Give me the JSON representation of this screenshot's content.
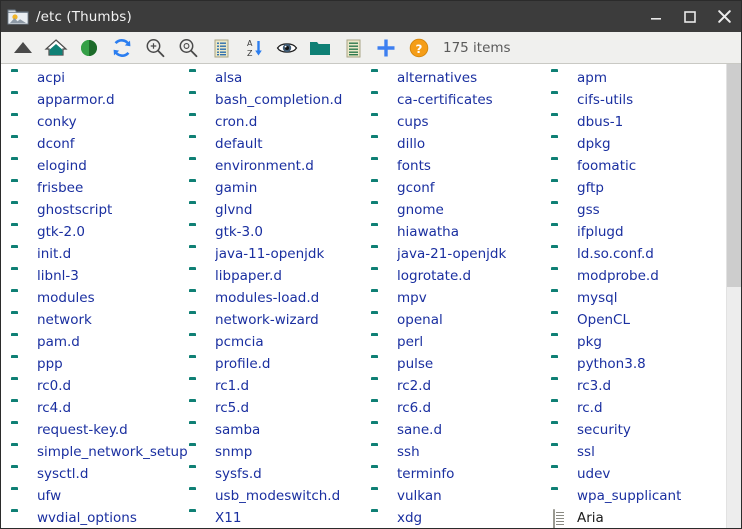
{
  "window": {
    "title": "/etc (Thumbs)",
    "app_icon": "folder-image-icon",
    "controls": {
      "minimize": "minimize-icon",
      "maximize": "maximize-icon",
      "close": "close-icon"
    }
  },
  "toolbar": {
    "status_text": "175 items",
    "buttons": [
      {
        "name": "up-icon",
        "title": "Up"
      },
      {
        "name": "home-icon",
        "title": "Home"
      },
      {
        "name": "back-icon",
        "title": "Back"
      },
      {
        "name": "refresh-icon",
        "title": "Refresh"
      },
      {
        "name": "zoom-in-icon",
        "title": "Zoom In"
      },
      {
        "name": "zoom-out-icon",
        "title": "Zoom Out"
      },
      {
        "name": "list-view-icon",
        "title": "List View"
      },
      {
        "name": "sort-az-icon",
        "title": "Sort A-Z"
      },
      {
        "name": "show-hidden-icon",
        "title": "Show Hidden"
      },
      {
        "name": "new-folder-icon",
        "title": "New Folder"
      },
      {
        "name": "details-icon",
        "title": "Details"
      },
      {
        "name": "add-icon",
        "title": "Add"
      },
      {
        "name": "help-icon",
        "title": "Help"
      }
    ]
  },
  "colors": {
    "titlebar_bg": "#3c3c3c",
    "toolbar_bg": "#f0f0ee",
    "folder_teal": "#0f8075",
    "label_blue": "#1a2fa0",
    "accent_orange": "#f59d17",
    "accent_blue": "#3d7ff0"
  },
  "files": {
    "columns": [
      [
        {
          "name": "acpi",
          "type": "folder"
        },
        {
          "name": "apparmor.d",
          "type": "folder"
        },
        {
          "name": "conky",
          "type": "folder"
        },
        {
          "name": "dconf",
          "type": "folder"
        },
        {
          "name": "elogind",
          "type": "folder"
        },
        {
          "name": "frisbee",
          "type": "folder"
        },
        {
          "name": "ghostscript",
          "type": "folder"
        },
        {
          "name": "gtk-2.0",
          "type": "folder"
        },
        {
          "name": "init.d",
          "type": "folder"
        },
        {
          "name": "libnl-3",
          "type": "folder"
        },
        {
          "name": "modules",
          "type": "folder"
        },
        {
          "name": "network",
          "type": "folder"
        },
        {
          "name": "pam.d",
          "type": "folder"
        },
        {
          "name": "ppp",
          "type": "folder"
        },
        {
          "name": "rc0.d",
          "type": "folder"
        },
        {
          "name": "rc4.d",
          "type": "folder"
        },
        {
          "name": "request-key.d",
          "type": "folder"
        },
        {
          "name": "simple_network_setup",
          "type": "folder"
        },
        {
          "name": "sysctl.d",
          "type": "folder"
        },
        {
          "name": "ufw",
          "type": "folder"
        },
        {
          "name": "wvdial_options",
          "type": "folder"
        }
      ],
      [
        {
          "name": "alsa",
          "type": "folder"
        },
        {
          "name": "bash_completion.d",
          "type": "folder"
        },
        {
          "name": "cron.d",
          "type": "folder"
        },
        {
          "name": "default",
          "type": "folder"
        },
        {
          "name": "environment.d",
          "type": "folder"
        },
        {
          "name": "gamin",
          "type": "folder"
        },
        {
          "name": "glvnd",
          "type": "folder"
        },
        {
          "name": "gtk-3.0",
          "type": "folder"
        },
        {
          "name": "java-11-openjdk",
          "type": "folder"
        },
        {
          "name": "libpaper.d",
          "type": "folder"
        },
        {
          "name": "modules-load.d",
          "type": "folder"
        },
        {
          "name": "network-wizard",
          "type": "folder"
        },
        {
          "name": "pcmcia",
          "type": "folder"
        },
        {
          "name": "profile.d",
          "type": "folder"
        },
        {
          "name": "rc1.d",
          "type": "folder"
        },
        {
          "name": "rc5.d",
          "type": "folder"
        },
        {
          "name": "samba",
          "type": "folder"
        },
        {
          "name": "snmp",
          "type": "folder"
        },
        {
          "name": "sysfs.d",
          "type": "folder"
        },
        {
          "name": "usb_modeswitch.d",
          "type": "folder"
        },
        {
          "name": "X11",
          "type": "folder"
        }
      ],
      [
        {
          "name": "alternatives",
          "type": "folder"
        },
        {
          "name": "ca-certificates",
          "type": "folder"
        },
        {
          "name": "cups",
          "type": "folder"
        },
        {
          "name": "dillo",
          "type": "folder"
        },
        {
          "name": "fonts",
          "type": "folder"
        },
        {
          "name": "gconf",
          "type": "folder"
        },
        {
          "name": "gnome",
          "type": "folder"
        },
        {
          "name": "hiawatha",
          "type": "folder"
        },
        {
          "name": "java-21-openjdk",
          "type": "folder"
        },
        {
          "name": "logrotate.d",
          "type": "folder"
        },
        {
          "name": "mpv",
          "type": "folder"
        },
        {
          "name": "openal",
          "type": "folder"
        },
        {
          "name": "perl",
          "type": "folder"
        },
        {
          "name": "pulse",
          "type": "folder"
        },
        {
          "name": "rc2.d",
          "type": "folder"
        },
        {
          "name": "rc6.d",
          "type": "folder"
        },
        {
          "name": "sane.d",
          "type": "folder"
        },
        {
          "name": "ssh",
          "type": "folder"
        },
        {
          "name": "terminfo",
          "type": "folder"
        },
        {
          "name": "vulkan",
          "type": "folder"
        },
        {
          "name": "xdg",
          "type": "folder"
        }
      ],
      [
        {
          "name": "apm",
          "type": "folder"
        },
        {
          "name": "cifs-utils",
          "type": "folder"
        },
        {
          "name": "dbus-1",
          "type": "folder"
        },
        {
          "name": "dpkg",
          "type": "folder"
        },
        {
          "name": "foomatic",
          "type": "folder"
        },
        {
          "name": "gftp",
          "type": "folder"
        },
        {
          "name": "gss",
          "type": "folder"
        },
        {
          "name": "ifplugd",
          "type": "folder"
        },
        {
          "name": "ld.so.conf.d",
          "type": "folder"
        },
        {
          "name": "modprobe.d",
          "type": "folder"
        },
        {
          "name": "mysql",
          "type": "folder"
        },
        {
          "name": "OpenCL",
          "type": "folder"
        },
        {
          "name": "pkg",
          "type": "folder"
        },
        {
          "name": "python3.8",
          "type": "folder"
        },
        {
          "name": "rc3.d",
          "type": "folder"
        },
        {
          "name": "rc.d",
          "type": "folder"
        },
        {
          "name": "security",
          "type": "folder"
        },
        {
          "name": "ssl",
          "type": "folder"
        },
        {
          "name": "udev",
          "type": "folder"
        },
        {
          "name": "wpa_supplicant",
          "type": "folder"
        },
        {
          "name": "Aria",
          "type": "document"
        }
      ]
    ]
  },
  "scrollbar": {
    "orientation": "vertical",
    "thumb_position_pct": 0,
    "thumb_size_pct": 48
  }
}
